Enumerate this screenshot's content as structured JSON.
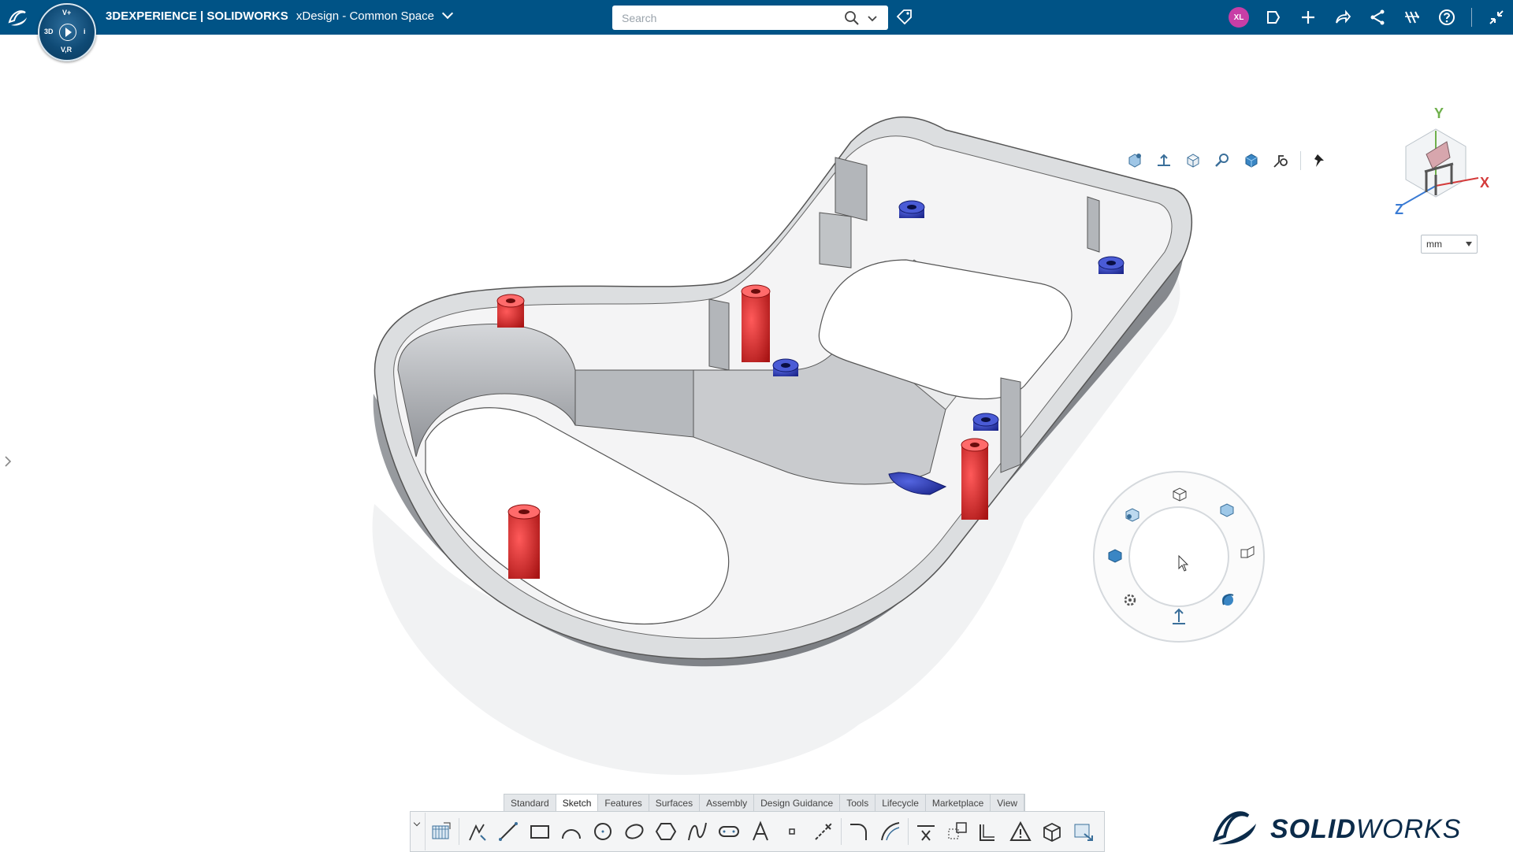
{
  "topbar": {
    "brand_bold_prefix": "3D",
    "brand_main": "EXPERIENCE | SOLIDWORKS",
    "space": "xDesign - Common Space",
    "search_placeholder": "Search",
    "avatar_initials": "XL",
    "compass_labels": {
      "north": "V+",
      "west": "3D",
      "east": "i",
      "south": "V,R"
    },
    "icons": [
      "ds-logo-icon",
      "compass-icon",
      "chevron-down-icon",
      "search-icon",
      "search-options-chevron-icon",
      "tag-icon",
      "notifications-icon",
      "add-icon",
      "share-forward-icon",
      "share-icon",
      "apps-icon",
      "help-icon",
      "collapse-icon"
    ]
  },
  "viewport": {
    "units_value": "mm",
    "triad_labels": {
      "x": "X",
      "y": "Y",
      "z": "Z"
    },
    "heads_up_icons": [
      "view-selector-icon",
      "normal-to-icon",
      "display-style-icon",
      "zoom-icon",
      "appearance-icon",
      "view-settings-icon",
      "pin-icon"
    ],
    "wheel_icons": [
      "front-view-icon",
      "top-view-icon",
      "right-view-icon",
      "back-view-icon",
      "left-view-icon",
      "isometric-view-icon",
      "bottom-view-icon",
      "settings-icon",
      "rotate-icon"
    ],
    "colors": {
      "boss_red": "#d52a2a",
      "boss_blue": "#2938b5",
      "part_gray": "#b9bbbe"
    }
  },
  "brand_logo": {
    "ds": "3DS",
    "solid": "SOLID",
    "works": "WORKS"
  },
  "command_tabs": [
    {
      "label": "Standard"
    },
    {
      "label": "Sketch",
      "active": true
    },
    {
      "label": "Features"
    },
    {
      "label": "Surfaces"
    },
    {
      "label": "Assembly"
    },
    {
      "label": "Design Guidance"
    },
    {
      "label": "Tools"
    },
    {
      "label": "Lifecycle"
    },
    {
      "label": "Marketplace"
    },
    {
      "label": "View"
    }
  ],
  "sketch_tools": [
    "sketch-icon",
    "sketch-select-icon",
    "line-icon",
    "rectangle-icon",
    "arc-icon",
    "circle-icon",
    "ellipse-icon",
    "polygon-icon",
    "spline-icon",
    "slot-icon",
    "text-icon",
    "point-icon",
    "construction-icon",
    "fillet-icon",
    "offset-icon",
    "trim-icon",
    "convert-entities-icon",
    "mirror-icon",
    "warning-icon",
    "cube-icon",
    "exit-sketch-icon"
  ]
}
